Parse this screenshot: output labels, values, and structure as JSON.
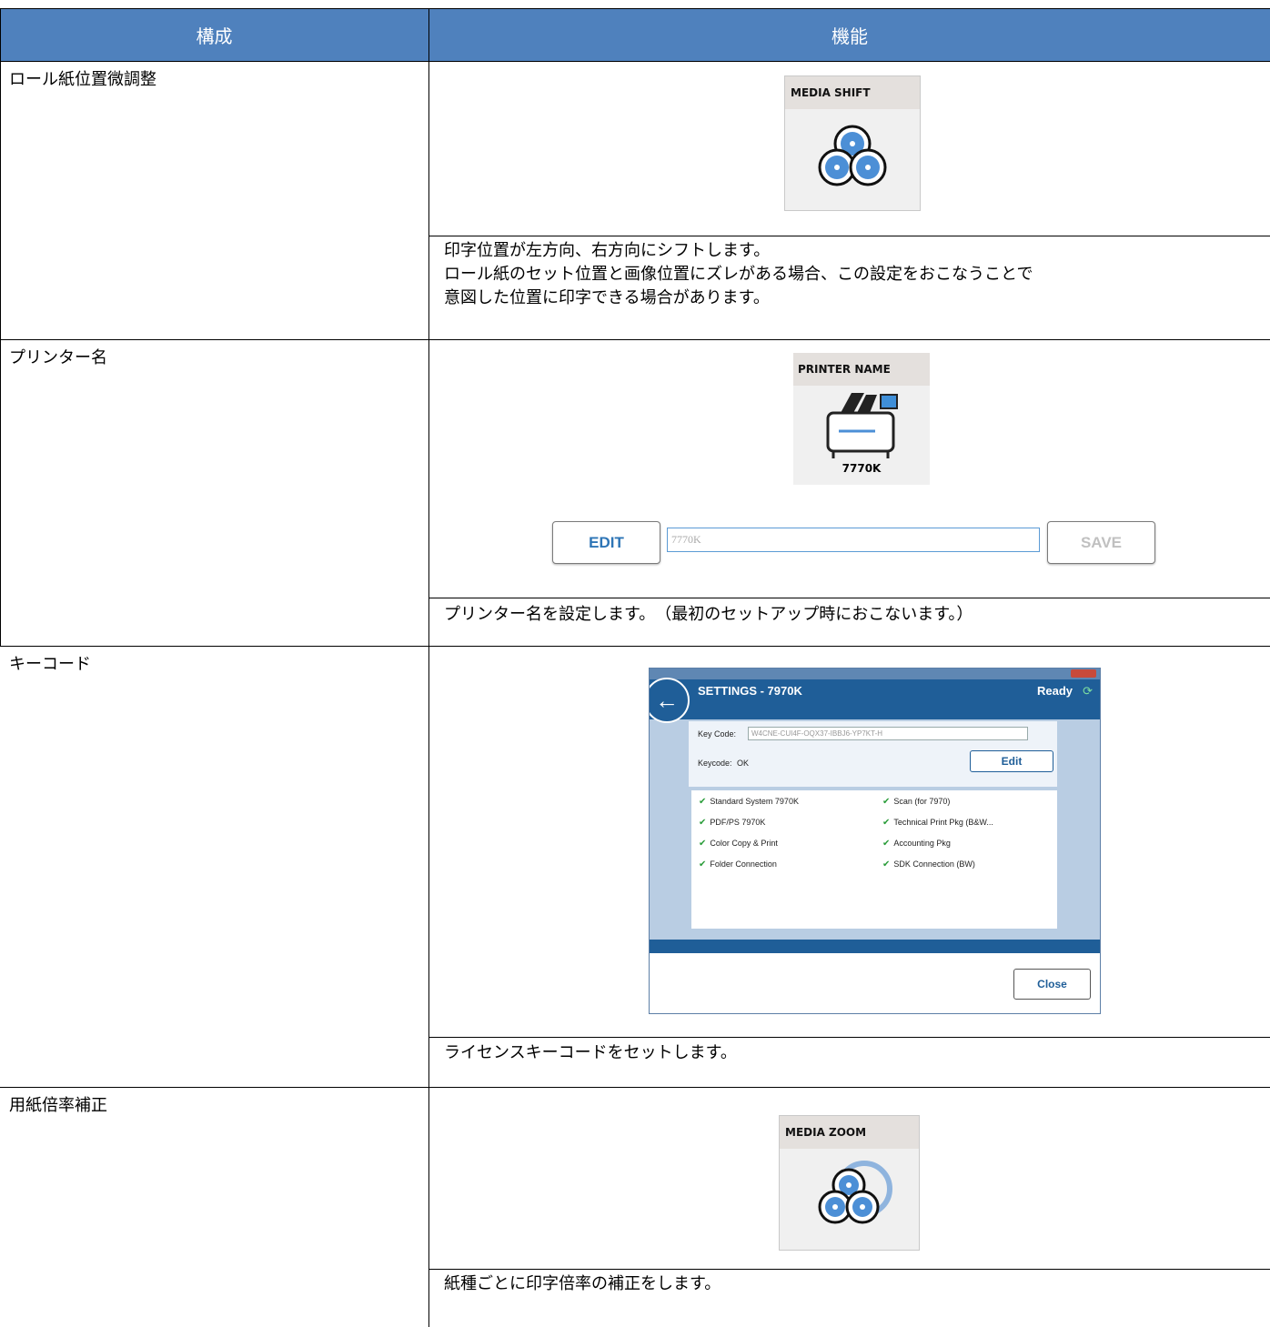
{
  "header": {
    "col1": "構成",
    "col2": "機能"
  },
  "rows": [
    {
      "label": "ロール紙位置微調整",
      "tile_title": "MEDIA SHIFT",
      "tile_icon": "media-shift-icon",
      "desc": [
        "印字位置が左方向、右方向にシフトします。",
        "ロール紙のセット位置と画像位置にズレがある場合、この設定をおこなうことで",
        "意図した位置に印字できる場合があります。"
      ]
    },
    {
      "label": "プリンター名",
      "tile_title": "PRINTER NAME",
      "tile_caption": "7770K",
      "tile_icon": "printer-icon",
      "edit_label": "EDIT",
      "input_value": "7770K",
      "save_label": "SAVE",
      "desc": [
        "プリンター名を設定します。　（最初のセットアップ時におこないます。）"
      ]
    },
    {
      "label": "キーコード",
      "desc": [
        "ライセンスキーコードをセットします。"
      ]
    },
    {
      "label": "用紙倍率補正",
      "tile_title": "MEDIA ZOOM",
      "tile_icon": "media-zoom-icon",
      "desc": [
        "紙種ごとに印字倍率の補正をします。"
      ]
    }
  ],
  "settings": {
    "title": "SETTINGS - 7970K",
    "status": "Ready",
    "key_code_label": "Key Code:",
    "key_code_value": "W4CNE-CUI4F-OQX37-IBBJ6-YP7KT-H",
    "keycode_status_label": "Keycode:",
    "keycode_status_value": "OK",
    "edit_label": "Edit",
    "close_label": "Close",
    "features_left": [
      "Standard System 7970K",
      "PDF/PS 7970K",
      "Color Copy & Print",
      "Folder Connection"
    ],
    "features_right": [
      "Scan (for 7970)",
      "Technical Print Pkg (B&W...",
      "Accounting Pkg",
      "SDK Connection (BW)"
    ]
  },
  "colors": {
    "header_bg": "#4f81bd",
    "settings_blue": "#1f5e98",
    "accent": "#2e75b6"
  }
}
